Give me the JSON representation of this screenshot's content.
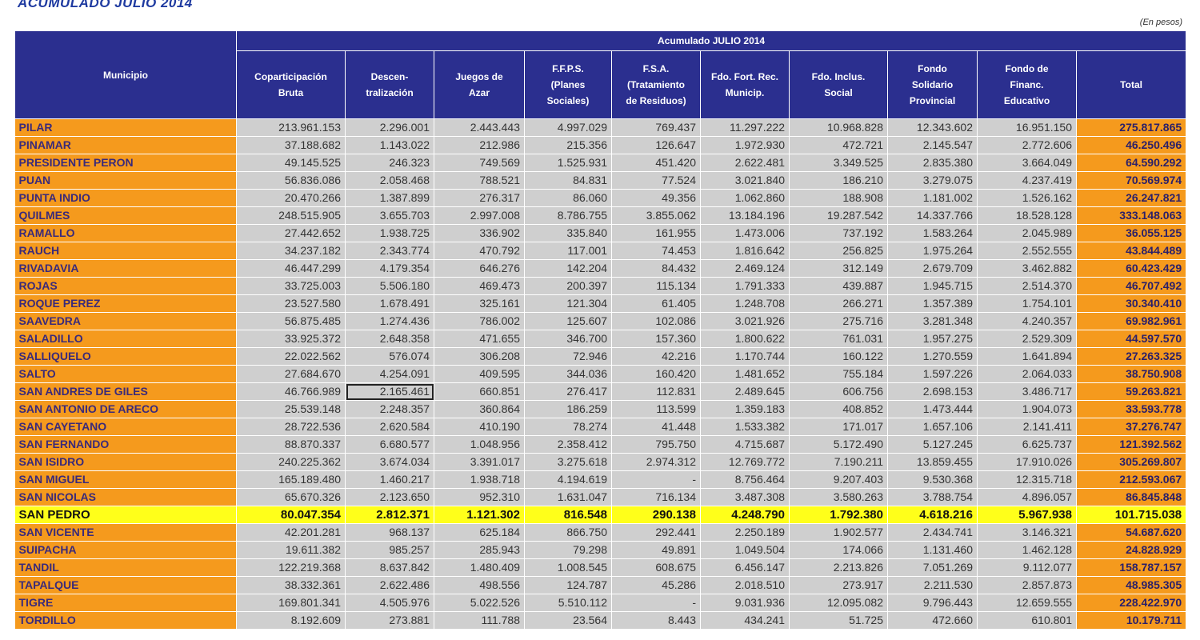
{
  "document": {
    "title": "ACUMULADO JULIO 2014",
    "units": "(En pesos)"
  },
  "table": {
    "municipio_header": "Municipio",
    "group_header": "Acumulado JULIO 2014",
    "columns": [
      "Coparticipación\nBruta",
      "Descen-\ntralización",
      "Juegos de\nAzar",
      "F.F.P.S.\n(Planes\nSociales)",
      "F.S.A.\n(Tratamiento\nde Residuos)",
      "Fdo. Fort. Rec.\nMunicip.",
      "Fdo. Inclus.\nSocial",
      "Fondo\nSolidario\nProvincial",
      "Fondo de\nFinanc.\nEducativo",
      "Total"
    ],
    "highlight_row": 22,
    "boxed_cell": {
      "row": 15,
      "col": 2
    },
    "rows": [
      [
        "PILAR",
        "213.961.153",
        "2.296.001",
        "2.443.443",
        "4.997.029",
        "769.437",
        "11.297.222",
        "10.968.828",
        "12.343.602",
        "16.951.150",
        "275.817.865"
      ],
      [
        "PINAMAR",
        "37.188.682",
        "1.143.022",
        "212.986",
        "215.356",
        "126.647",
        "1.972.930",
        "472.721",
        "2.145.547",
        "2.772.606",
        "46.250.496"
      ],
      [
        "PRESIDENTE PERON",
        "49.145.525",
        "246.323",
        "749.569",
        "1.525.931",
        "451.420",
        "2.622.481",
        "3.349.525",
        "2.835.380",
        "3.664.049",
        "64.590.292"
      ],
      [
        "PUAN",
        "56.836.086",
        "2.058.468",
        "788.521",
        "84.831",
        "77.524",
        "3.021.840",
        "186.210",
        "3.279.075",
        "4.237.419",
        "70.569.974"
      ],
      [
        "PUNTA INDIO",
        "20.470.266",
        "1.387.899",
        "276.317",
        "86.060",
        "49.356",
        "1.062.860",
        "188.908",
        "1.181.002",
        "1.526.162",
        "26.247.821"
      ],
      [
        "QUILMES",
        "248.515.905",
        "3.655.703",
        "2.997.008",
        "8.786.755",
        "3.855.062",
        "13.184.196",
        "19.287.542",
        "14.337.766",
        "18.528.128",
        "333.148.063"
      ],
      [
        "RAMALLO",
        "27.442.652",
        "1.938.725",
        "336.902",
        "335.840",
        "161.955",
        "1.473.006",
        "737.192",
        "1.583.264",
        "2.045.989",
        "36.055.125"
      ],
      [
        "RAUCH",
        "34.237.182",
        "2.343.774",
        "470.792",
        "117.001",
        "74.453",
        "1.816.642",
        "256.825",
        "1.975.264",
        "2.552.555",
        "43.844.489"
      ],
      [
        "RIVADAVIA",
        "46.447.299",
        "4.179.354",
        "646.276",
        "142.204",
        "84.432",
        "2.469.124",
        "312.149",
        "2.679.709",
        "3.462.882",
        "60.423.429"
      ],
      [
        "ROJAS",
        "33.725.003",
        "5.506.180",
        "469.473",
        "200.397",
        "115.134",
        "1.791.333",
        "439.887",
        "1.945.715",
        "2.514.370",
        "46.707.492"
      ],
      [
        "ROQUE PEREZ",
        "23.527.580",
        "1.678.491",
        "325.161",
        "121.304",
        "61.405",
        "1.248.708",
        "266.271",
        "1.357.389",
        "1.754.101",
        "30.340.410"
      ],
      [
        "SAAVEDRA",
        "56.875.485",
        "1.274.436",
        "786.002",
        "125.607",
        "102.086",
        "3.021.926",
        "275.716",
        "3.281.348",
        "4.240.357",
        "69.982.961"
      ],
      [
        "SALADILLO",
        "33.925.372",
        "2.648.358",
        "471.655",
        "346.700",
        "157.360",
        "1.800.622",
        "761.031",
        "1.957.275",
        "2.529.309",
        "44.597.570"
      ],
      [
        "SALLIQUELO",
        "22.022.562",
        "576.074",
        "306.208",
        "72.946",
        "42.216",
        "1.170.744",
        "160.122",
        "1.270.559",
        "1.641.894",
        "27.263.325"
      ],
      [
        "SALTO",
        "27.684.670",
        "4.254.091",
        "409.595",
        "344.036",
        "160.420",
        "1.481.652",
        "755.184",
        "1.597.226",
        "2.064.033",
        "38.750.908"
      ],
      [
        "SAN ANDRES DE GILES",
        "46.766.989",
        "2.165.461",
        "660.851",
        "276.417",
        "112.831",
        "2.489.645",
        "606.756",
        "2.698.153",
        "3.486.717",
        "59.263.821"
      ],
      [
        "SAN ANTONIO DE ARECO",
        "25.539.148",
        "2.248.357",
        "360.864",
        "186.259",
        "113.599",
        "1.359.183",
        "408.852",
        "1.473.444",
        "1.904.073",
        "33.593.778"
      ],
      [
        "SAN CAYETANO",
        "28.722.536",
        "2.620.584",
        "410.190",
        "78.274",
        "41.448",
        "1.533.382",
        "171.017",
        "1.657.106",
        "2.141.411",
        "37.276.747"
      ],
      [
        "SAN FERNANDO",
        "88.870.337",
        "6.680.577",
        "1.048.956",
        "2.358.412",
        "795.750",
        "4.715.687",
        "5.172.490",
        "5.127.245",
        "6.625.737",
        "121.392.562"
      ],
      [
        "SAN ISIDRO",
        "240.225.362",
        "3.674.034",
        "3.391.017",
        "3.275.618",
        "2.974.312",
        "12.769.772",
        "7.190.211",
        "13.859.455",
        "17.910.026",
        "305.269.807"
      ],
      [
        "SAN MIGUEL",
        "165.189.480",
        "1.460.217",
        "1.938.718",
        "4.194.619",
        "-",
        "8.756.464",
        "9.207.403",
        "9.530.368",
        "12.315.718",
        "212.593.067"
      ],
      [
        "SAN NICOLAS",
        "65.670.326",
        "2.123.650",
        "952.310",
        "1.631.047",
        "716.134",
        "3.487.308",
        "3.580.263",
        "3.788.754",
        "4.896.057",
        "86.845.848"
      ],
      [
        "SAN PEDRO",
        "80.047.354",
        "2.812.371",
        "1.121.302",
        "816.548",
        "290.138",
        "4.248.790",
        "1.792.380",
        "4.618.216",
        "5.967.938",
        "101.715.038"
      ],
      [
        "SAN VICENTE",
        "42.201.281",
        "968.137",
        "625.184",
        "866.750",
        "292.441",
        "2.250.189",
        "1.902.577",
        "2.434.741",
        "3.146.321",
        "54.687.620"
      ],
      [
        "SUIPACHA",
        "19.611.382",
        "985.257",
        "285.943",
        "79.298",
        "49.891",
        "1.049.504",
        "174.066",
        "1.131.460",
        "1.462.128",
        "24.828.929"
      ],
      [
        "TANDIL",
        "122.219.368",
        "8.637.842",
        "1.480.409",
        "1.008.545",
        "608.675",
        "6.456.147",
        "2.213.826",
        "7.051.269",
        "9.112.077",
        "158.787.157"
      ],
      [
        "TAPALQUE",
        "38.332.361",
        "2.622.486",
        "498.556",
        "124.787",
        "45.286",
        "2.018.510",
        "273.917",
        "2.211.530",
        "2.857.873",
        "48.985.305"
      ],
      [
        "TIGRE",
        "169.801.341",
        "4.505.976",
        "5.022.526",
        "5.510.112",
        "-",
        "9.031.936",
        "12.095.082",
        "9.796.443",
        "12.659.555",
        "228.422.970"
      ],
      [
        "TORDILLO",
        "8.192.609",
        "273.881",
        "111.788",
        "23.564",
        "8.443",
        "434.241",
        "51.725",
        "472.660",
        "610.801",
        "10.179.711"
      ]
    ]
  }
}
